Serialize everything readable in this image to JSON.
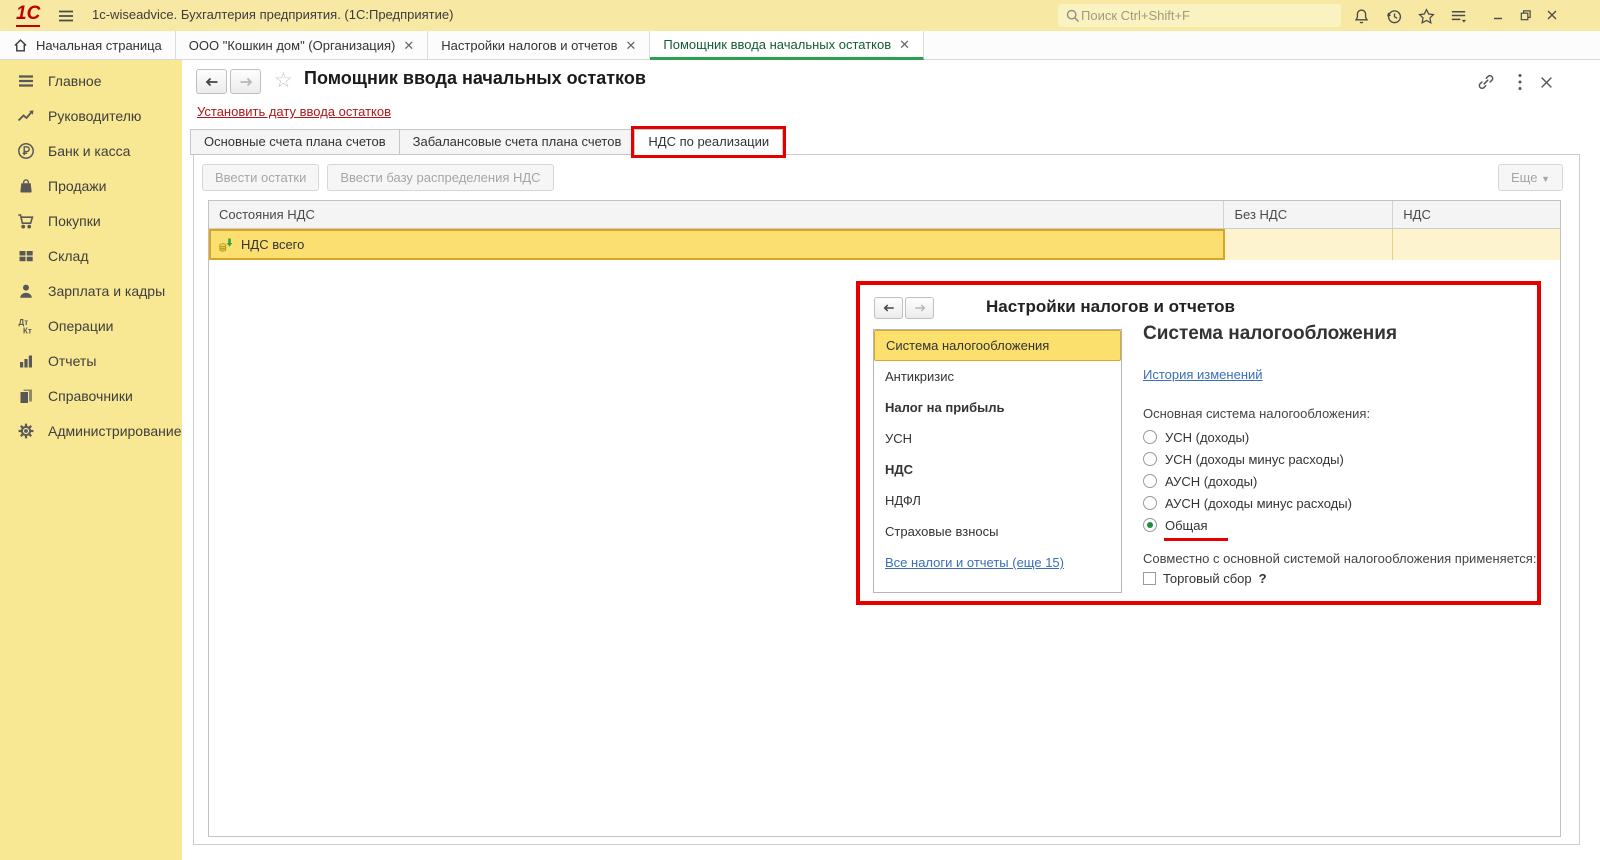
{
  "titlebar": {
    "logo": "1С",
    "title": "1c-wiseadvice. Бухгалтерия предприятия. (1С:Предприятие)",
    "search_placeholder": "Поиск Ctrl+Shift+F",
    "icons": [
      "menu-icon",
      "search-icon",
      "bell-icon",
      "history-icon",
      "favorites-star-icon",
      "functions-menu-icon",
      "minimize-icon",
      "restore-icon",
      "close-icon"
    ]
  },
  "window_tabs": [
    {
      "label": "Начальная страница",
      "icon": "home-icon"
    },
    {
      "label": "ООО \"Кошкин дом\" (Организация)"
    },
    {
      "label": "Настройки налогов и отчетов"
    },
    {
      "label": "Помощник ввода начальных остатков"
    }
  ],
  "sidebar": {
    "items": [
      {
        "label": "Главное",
        "icon": "menu-lines-icon"
      },
      {
        "label": "Руководителю",
        "icon": "trend-icon"
      },
      {
        "label": "Банк и касса",
        "icon": "ruble-icon"
      },
      {
        "label": "Продажи",
        "icon": "bag-icon"
      },
      {
        "label": "Покупки",
        "icon": "cart-icon"
      },
      {
        "label": "Склад",
        "icon": "grid-icon"
      },
      {
        "label": "Зарплата и кадры",
        "icon": "person-icon"
      },
      {
        "label": "Операции",
        "icon": "dtkt-icon"
      },
      {
        "label": "Отчеты",
        "icon": "bars-icon"
      },
      {
        "label": "Справочники",
        "icon": "books-icon"
      },
      {
        "label": "Администрирование",
        "icon": "gear-icon"
      }
    ]
  },
  "main": {
    "title": "Помощник ввода начальных остатков",
    "set_date_link": "Установить дату ввода остатков",
    "tabs": [
      {
        "label": "Основные счета плана счетов"
      },
      {
        "label": "Забалансовые счета плана счетов"
      },
      {
        "label": "НДС по реализации",
        "active": true,
        "annotated": true
      }
    ],
    "buttons": [
      {
        "label": "Ввести остатки",
        "enabled": false
      },
      {
        "label": "Ввести базу распределения НДС",
        "enabled": false
      }
    ],
    "more_label": "Еще",
    "table": {
      "columns": [
        "Состояния НДС",
        "Без НДС",
        "НДС"
      ],
      "rows": [
        {
          "name": "НДС всего",
          "no_vat": "",
          "vat": "",
          "icon": "vat-coins-icon"
        }
      ]
    }
  },
  "dialog": {
    "title": "Настройки налогов и отчетов",
    "nav": {
      "items": [
        {
          "label": "Система налогообложения",
          "selected": true
        },
        {
          "label": "Антикризис"
        },
        {
          "label": "Налог на прибыль",
          "bold": true
        },
        {
          "label": "УСН"
        },
        {
          "label": "НДС",
          "bold": true
        },
        {
          "label": "НДФЛ"
        },
        {
          "label": "Страховые взносы"
        }
      ],
      "link_label": "Все налоги и отчеты (еще 15)"
    },
    "panel": {
      "heading": "Система налогообложения",
      "history_link": "История изменений",
      "group_label": "Основная система налогообложения:",
      "radios": [
        {
          "label": "УСН (доходы)",
          "selected": false
        },
        {
          "label": "УСН (доходы минус расходы)",
          "selected": false
        },
        {
          "label": "АУСН (доходы)",
          "selected": false
        },
        {
          "label": "АУСН (доходы минус расходы)",
          "selected": false
        },
        {
          "label": "Общая",
          "selected": true,
          "underline_annotation": true
        }
      ],
      "secondary_label": "Совместно с основной системой налогообложения применяется:",
      "checkbox": {
        "label": "Торговый сбор",
        "help": "?",
        "checked": false
      }
    }
  },
  "colors": {
    "titlebar_yellow": "#f7e8a3",
    "sidebar_yellow": "#f8e893",
    "selection_yellow": "#fbdf71",
    "selection_border": "#d9a323",
    "active_tab_green": "#2aa053",
    "annotation_red": "#e50000",
    "link_blue": "#3a6fb8",
    "link_red": "#b0171a",
    "radio_green": "#1e8e3e",
    "logo_red": "#c00000"
  }
}
